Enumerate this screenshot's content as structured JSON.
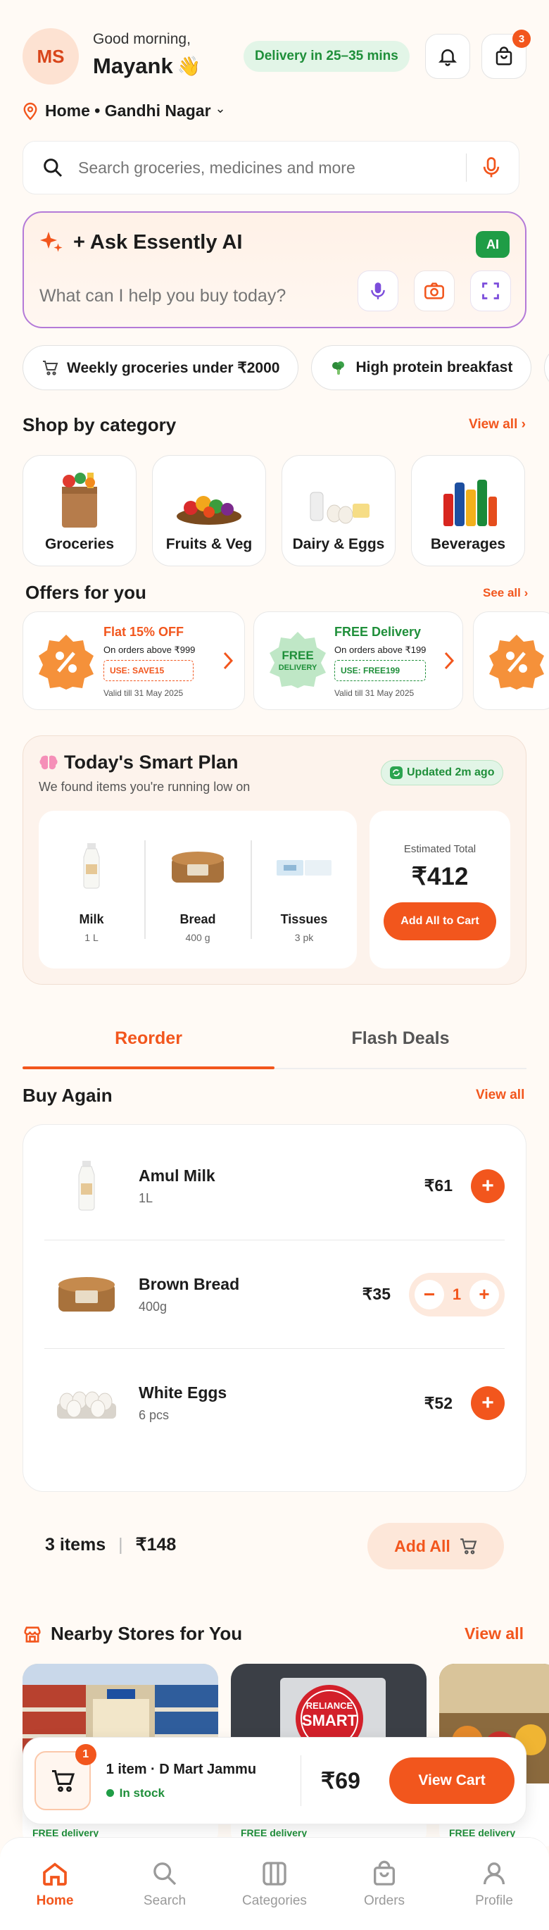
{
  "header": {
    "avatar_initials": "MS",
    "greeting": "Good morning,",
    "name": "Mayank",
    "wave": "👋",
    "delivery_badge": "Delivery in 25–35 mins",
    "cart_count": "3"
  },
  "location": {
    "label": "Home • Gandhi Nagar",
    "chevron": "⌄"
  },
  "search": {
    "placeholder": "Search groceries, medicines and more"
  },
  "ai": {
    "title": "+ Ask Essently AI",
    "badge": "AI",
    "placeholder": "What can I help you buy today?"
  },
  "chips": [
    {
      "label": "Weekly groceries under ₹2000",
      "icon": "cart-icon"
    },
    {
      "label": "High protein breakfast",
      "icon": "broccoli-icon"
    }
  ],
  "categories": {
    "title": "Shop by category",
    "view_all": "View all ›",
    "items": [
      {
        "label": "Groceries",
        "icon": "grocery-bag-icon"
      },
      {
        "label": "Fruits & Veg",
        "icon": "fruits-icon"
      },
      {
        "label": "Dairy & Eggs",
        "icon": "dairy-icon"
      },
      {
        "label": "Beverages",
        "icon": "beverages-icon"
      }
    ]
  },
  "offers": {
    "title": "Offers for you",
    "see_all": "See all ›",
    "items": [
      {
        "title": "Flat 15% OFF",
        "condition": "On orders above ₹999",
        "code": "USE: SAVE15",
        "valid": "Valid till 31 May 2025",
        "accent": "#f2561d"
      },
      {
        "title": "FREE Delivery",
        "condition": "On orders above ₹199",
        "code": "USE: FREE199",
        "valid": "Valid till 31 May 2025",
        "badge_line1": "FREE",
        "badge_line2": "DELIVERY",
        "accent": "#1f8f3a"
      }
    ]
  },
  "smart_plan": {
    "title": "Today's Smart Plan",
    "subtitle": "We found items you're running low on",
    "updated": "Updated 2m ago",
    "items": [
      {
        "name": "Milk",
        "qty": "1 L"
      },
      {
        "name": "Bread",
        "qty": "400 g"
      },
      {
        "name": "Tissues",
        "qty": "3 pk"
      }
    ],
    "total_label": "Estimated Total",
    "total": "₹412",
    "cta": "Add All to Cart"
  },
  "tabs": [
    {
      "label": "Reorder",
      "active": true
    },
    {
      "label": "Flash Deals",
      "active": false
    }
  ],
  "buy_again": {
    "title": "Buy Again",
    "view_all": "View all",
    "items": [
      {
        "name": "Amul Milk",
        "qty": "1L",
        "price": "₹61"
      },
      {
        "name": "Brown Bread",
        "qty": "400g",
        "price": "₹35",
        "count": "1"
      },
      {
        "name": "White Eggs",
        "qty": "6 pcs",
        "price": "₹52"
      }
    ],
    "summary_count": "3 items",
    "summary_total": "₹148",
    "add_all": "Add All"
  },
  "stores": {
    "title": "Nearby Stores for You",
    "view_all": "View all",
    "items": [
      {
        "delivery": "FREE delivery"
      },
      {
        "delivery": "FREE delivery",
        "sign_line1": "RELIANCE",
        "sign_line2": "SMART"
      },
      {
        "delivery": "FREE delivery"
      }
    ]
  },
  "cart_bar": {
    "badge": "1",
    "summary": "1 item · D Mart Jammu",
    "status": "In stock",
    "price": "₹69",
    "cta": "View Cart"
  },
  "bottom_nav": [
    {
      "label": "Home",
      "icon": "home-icon",
      "active": true
    },
    {
      "label": "Search",
      "icon": "search-icon",
      "active": false
    },
    {
      "label": "Categories",
      "icon": "categories-icon",
      "active": false
    },
    {
      "label": "Orders",
      "icon": "bag-icon",
      "active": false
    },
    {
      "label": "Profile",
      "icon": "profile-icon",
      "active": false
    }
  ],
  "colors": {
    "accent": "#f2561d",
    "success": "#1f8f3a",
    "ai_border": "#7c4ddb",
    "background": "#fffaf5"
  }
}
